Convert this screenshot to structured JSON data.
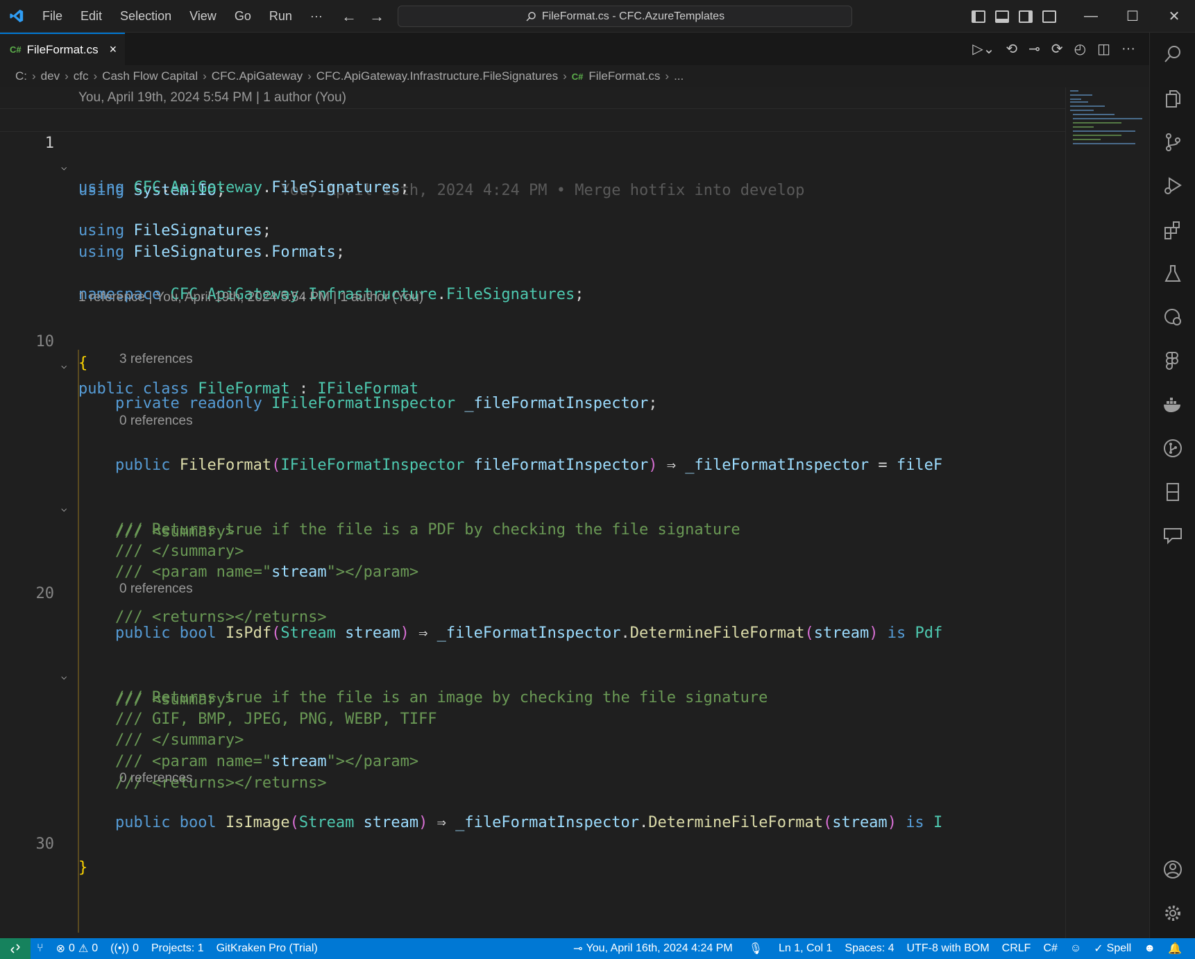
{
  "titlebar": {
    "menu": [
      "File",
      "Edit",
      "Selection",
      "View",
      "Go",
      "Run",
      "···"
    ],
    "search_text": "FileFormat.cs - CFC.AzureTemplates"
  },
  "tab": {
    "badge": "C#",
    "label": "FileFormat.cs",
    "close": "×"
  },
  "breadcrumb": [
    "C:",
    "dev",
    "cfc",
    "Cash Flow Capital",
    "CFC.ApiGateway",
    "CFC.ApiGateway.Infrastructure.FileSignatures",
    "FileFormat.cs",
    "..."
  ],
  "breadcrumb_badge": "C#",
  "editor": {
    "lens_top": "You, April 19th, 2024 5:54 PM | 1 author (You)",
    "blame_line1": "You, April 16th, 2024 4:24 PM • Merge hotfix into develop",
    "lens_class": "1 reference | You, April 19th, 2024 5:54 PM | 1 author (You)",
    "lens_field": "3 references",
    "lens_ctor": "0 references",
    "lens_ispdf": "0 references",
    "lens_isimage": "0 references",
    "line_numbers": {
      "l1": "1",
      "l10": "10",
      "l20": "20",
      "l30": "30"
    },
    "code": {
      "using1_ns": "System.IO",
      "using2_ns_a": "CFC",
      "using2_ns_b": "ApiGateway",
      "using2_ns_c": "FileSignatures",
      "using3_ns": "FileSignatures",
      "using4_ns_a": "FileSignatures",
      "using4_ns_b": "Formats",
      "namespace_a": "CFC",
      "namespace_b": "ApiGateway",
      "namespace_c": "Infrastructure",
      "namespace_d": "FileSignatures",
      "class_name": "FileFormat",
      "interface_name": "IFileFormat",
      "field_type": "IFileFormatInspector",
      "field_name": "_fileFormatInspector",
      "ctor_name": "FileFormat",
      "ctor_param_type": "IFileFormatInspector",
      "ctor_param_name": "fileFormatInspector",
      "ctor_body_a": "_fileFormatInspector",
      "ctor_body_b": "fileF",
      "doc_summary_open": "/// <summary>",
      "doc_pdf_text": "/// Returns true if the file is a PDF by checking the file signature",
      "doc_summary_close": "/// </summary>",
      "doc_param_a": "/// <param name=\"",
      "doc_param_name": "stream",
      "doc_param_b": "\"></param>",
      "doc_returns": "/// <returns></returns>",
      "ispdf_name": "IsPdf",
      "param_type": "Stream",
      "param_name": "stream",
      "inspector": "_fileFormatInspector",
      "determine": "DetermineFileFormat",
      "ispdf_tail": "Pdf",
      "doc_image_text": "/// Returns true if the file is an image by checking the file signature",
      "doc_image_formats": "/// GIF, BMP, JPEG, PNG, WEBP, TIFF",
      "isimage_name": "IsImage",
      "isimage_tail": "I"
    }
  },
  "statusbar": {
    "errors": "0",
    "warnings": "0",
    "ports": "0",
    "projects": "Projects: 1",
    "gitkraken": "GitKraken Pro (Trial)",
    "blame": "You, April 16th, 2024 4:24 PM",
    "position": "Ln 1, Col 1",
    "spaces": "Spaces: 4",
    "encoding": "UTF-8 with BOM",
    "eol": "CRLF",
    "language": "C#",
    "spell": "Spell"
  },
  "colors": {
    "accent": "#0078d4",
    "remote": "#16825d",
    "keyword": "#569cd6",
    "type": "#4ec9b0",
    "comment": "#6a9955"
  }
}
